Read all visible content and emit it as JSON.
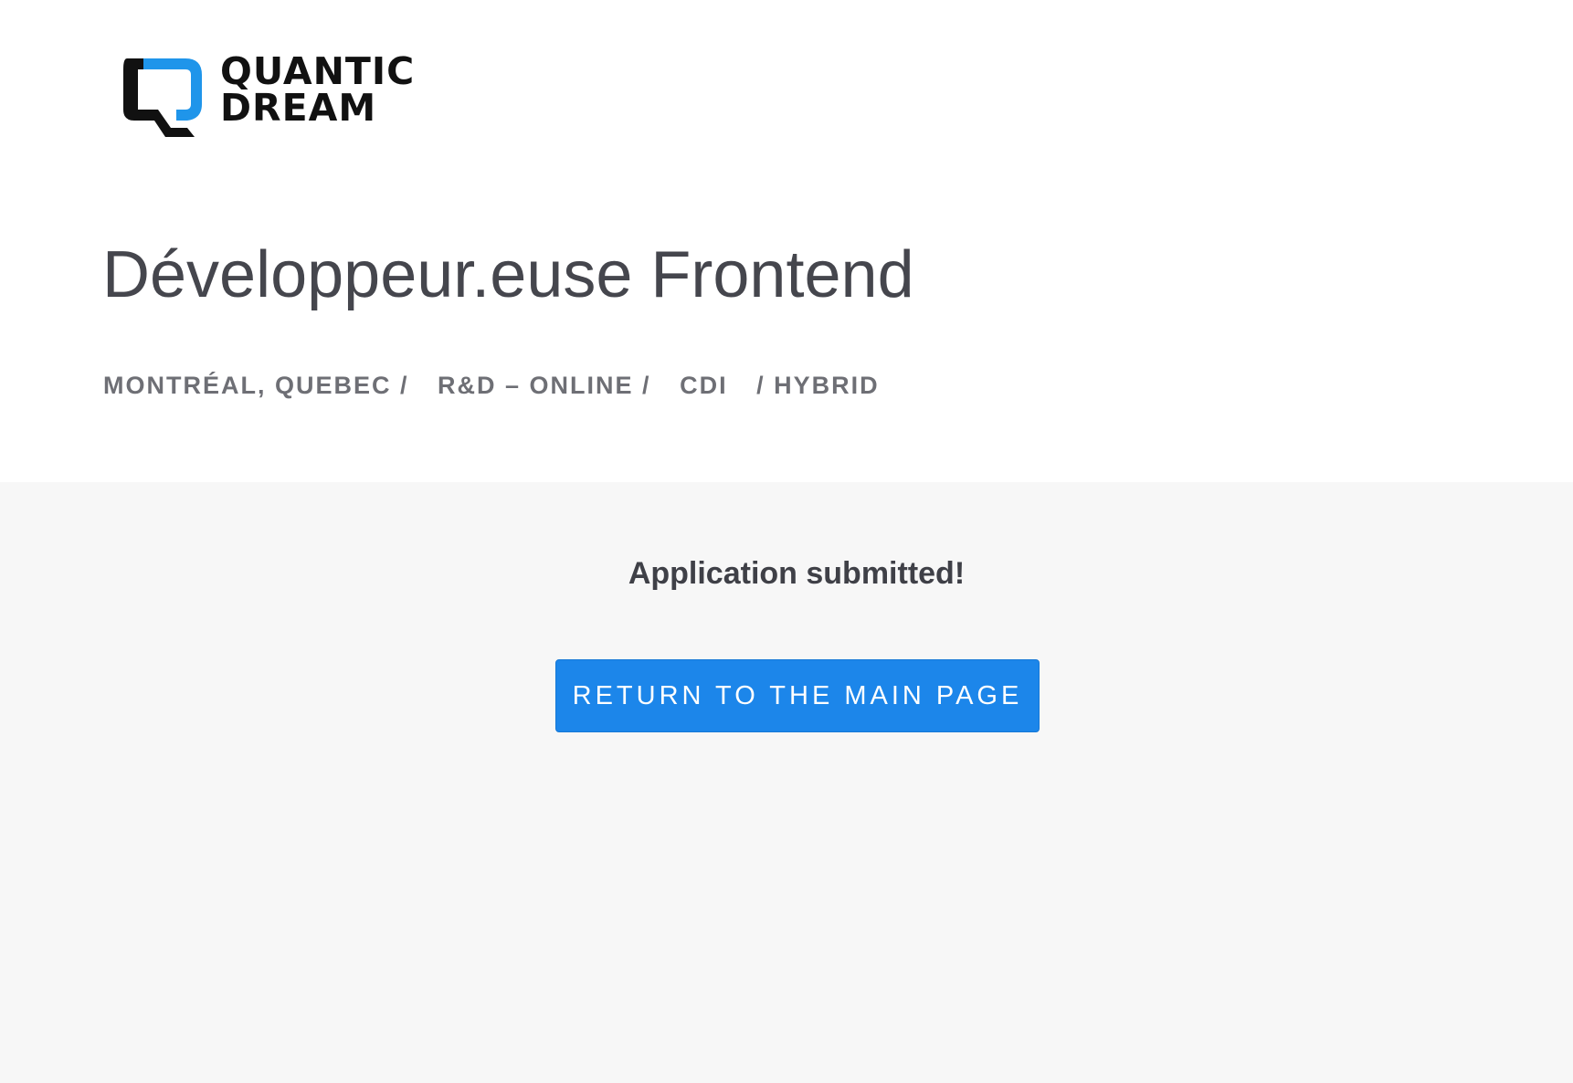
{
  "brand": {
    "name_line1": "QUANTIC",
    "name_line2": "DREAM",
    "accent_color": "#1f95ea",
    "mark_color": "#111111"
  },
  "job": {
    "title": "Développeur.euse Frontend",
    "location": "MONTRÉAL, QUEBEC /",
    "team": "R&D – ONLINE /",
    "contract": "CDI",
    "workplace": "/ HYBRID"
  },
  "confirmation": {
    "message": "Application submitted!",
    "return_label": "RETURN TO THE MAIN PAGE"
  },
  "colors": {
    "button": "#1c86ea",
    "page_background": "#f7f7f7",
    "header_background": "#ffffff"
  }
}
